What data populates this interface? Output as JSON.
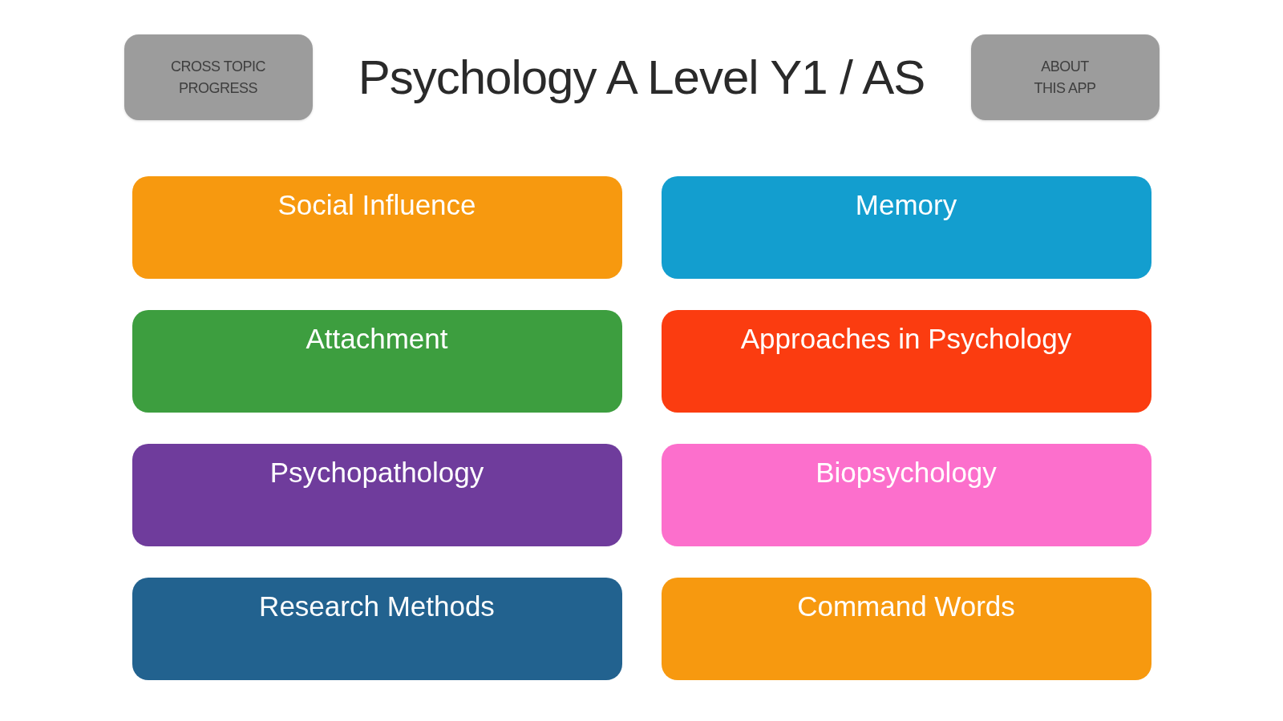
{
  "header": {
    "left_button": {
      "label": "CROSS TOPIC\nPROGRESS"
    },
    "title": "Psychology A Level Y1 / AS",
    "right_button": {
      "label": "ABOUT\nTHIS APP"
    }
  },
  "topics": [
    {
      "label": "Social Influence",
      "color": "#f7990f"
    },
    {
      "label": "Memory",
      "color": "#139ecf"
    },
    {
      "label": "Attachment",
      "color": "#3d9e3f"
    },
    {
      "label": "Approaches in Psychology",
      "color": "#fb3c10"
    },
    {
      "label": "Psychopathology",
      "color": "#6f3c9c"
    },
    {
      "label": "Biopsychology",
      "color": "#fc6fcc"
    },
    {
      "label": "Research Methods",
      "color": "#22628f"
    },
    {
      "label": "Command Words",
      "color": "#f7990f"
    }
  ]
}
